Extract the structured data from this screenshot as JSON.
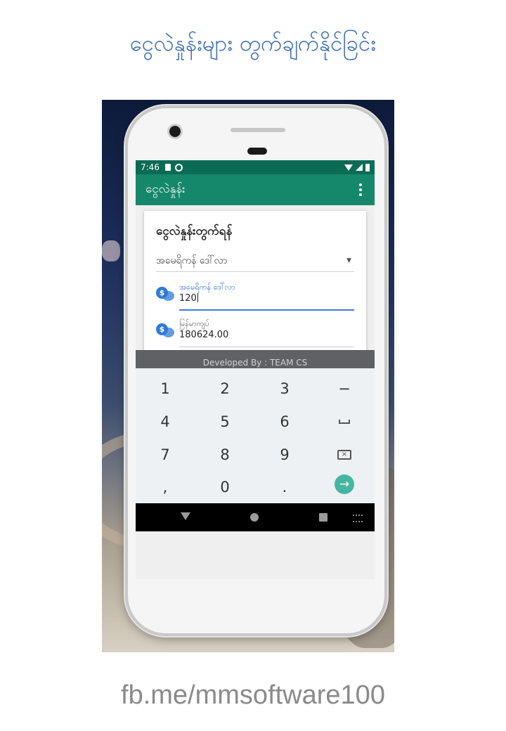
{
  "banner": {
    "headline": "ငွေလဲနှုန်းများ တွက်ချက်နိုင်ခြင်း",
    "url": "fb.me/mmsoftware100"
  },
  "status_bar": {
    "time": "7:46"
  },
  "app_bar": {
    "title": "ငွေလဲနှုန်း"
  },
  "converter": {
    "title": "ငွေလဲနှုန်းတွက်ရန်",
    "currency_selected": "အမေရိကန် ဒေါ်လာ",
    "input": {
      "label": "အမေရိကန် ဒေါ်လာ",
      "value": "120"
    },
    "output": {
      "label": "မြန်မာကျပ်",
      "value": "180624.00"
    },
    "coin_symbol": "$"
  },
  "footer": {
    "developer": "Developed By : TEAM CS"
  },
  "keyboard": {
    "keys": [
      "1",
      "2",
      "3",
      "−",
      "4",
      "5",
      "6",
      "␣",
      "7",
      "8",
      "9",
      "⌫",
      ",",
      "0",
      ".",
      "→"
    ]
  },
  "colors": {
    "status_bar": "#0b6b55",
    "app_bar": "#15876b",
    "accent": "#3c7be0",
    "enter_key": "#46b6a2",
    "headline": "#3e6fb4"
  }
}
